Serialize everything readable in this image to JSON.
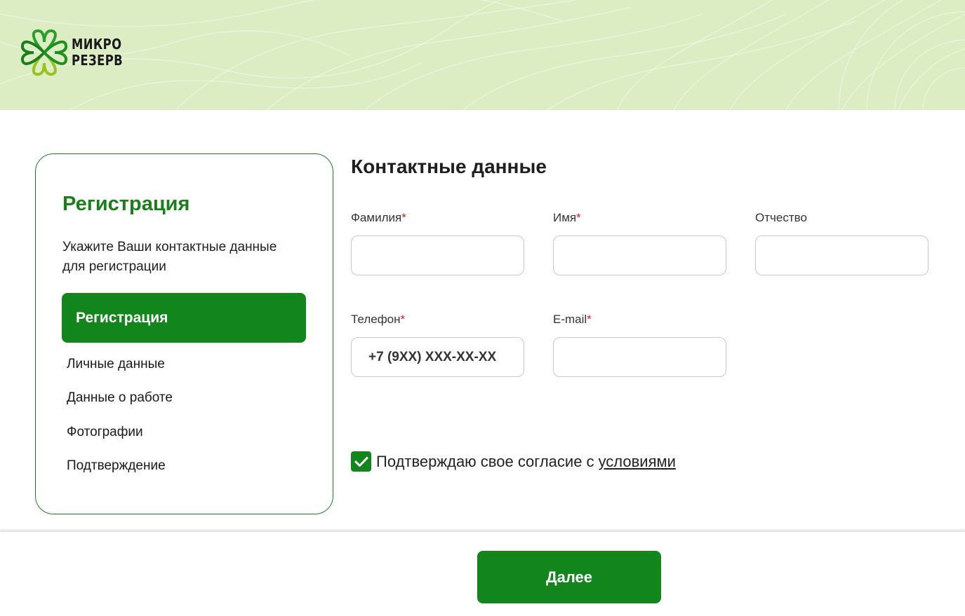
{
  "brand": {
    "logo_line1": "МИКРО",
    "logo_line2": "РЕЗЕРВ",
    "logo_icon": "clover-logo-icon",
    "header_bg": "#dcedc4",
    "accent": "#12861c"
  },
  "sidebar": {
    "title": "Регистрация",
    "description": "Укажите Ваши контактные данные для регистрации",
    "active_step": "Регистрация",
    "steps": [
      "Личные данные",
      "Данные о работе",
      "Фотографии",
      "Подтверждение"
    ]
  },
  "form": {
    "title": "Контактные данные",
    "fields": {
      "last_name": {
        "label": "Фамилия",
        "required": "*",
        "value": ""
      },
      "first_name": {
        "label": "Имя",
        "required": "*",
        "value": ""
      },
      "middle_name": {
        "label": "Отчество",
        "value": ""
      },
      "phone": {
        "label": "Телефон",
        "required": "*",
        "placeholder": "+7 (9XX) XXX-XX-XX"
      },
      "email": {
        "label": "E-mail",
        "required": "*",
        "value": ""
      }
    },
    "consent": {
      "text": "Подтверждаю свое согласие с",
      "link": "условиями",
      "checked": true,
      "check_icon": "checkmark-icon"
    }
  },
  "footer": {
    "next_label": "Далее"
  }
}
